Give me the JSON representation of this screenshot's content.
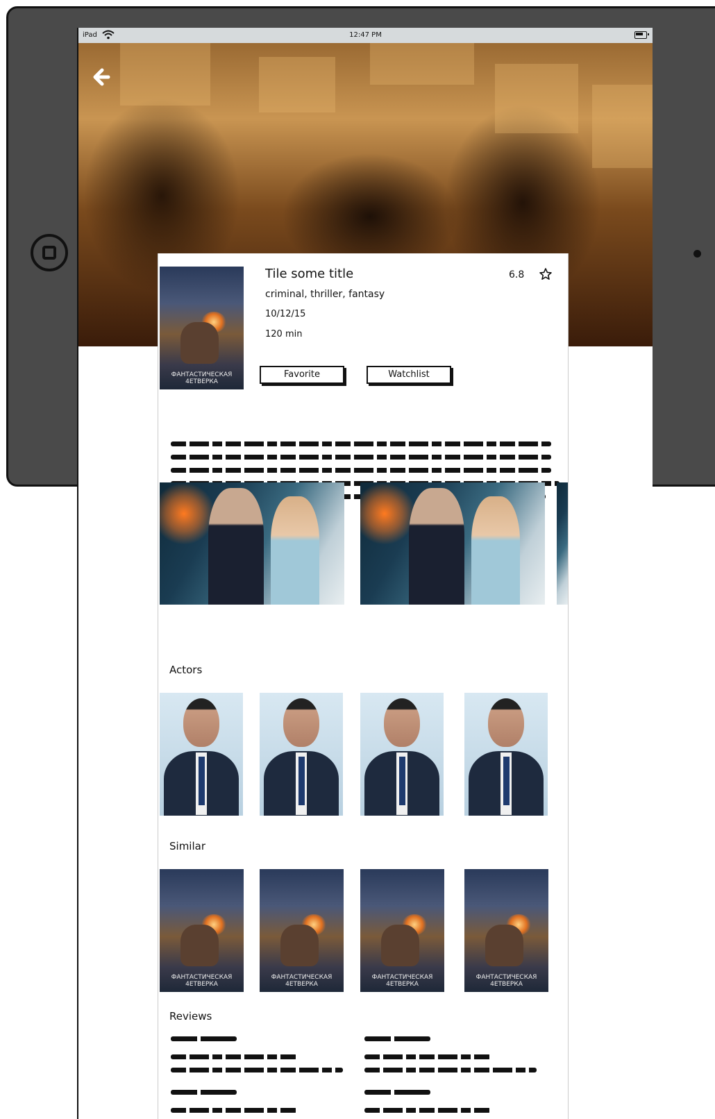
{
  "status_bar": {
    "carrier": "iPad",
    "time": "12:47 PM"
  },
  "movie": {
    "title": "Tile some title",
    "rating": "6.8",
    "genres": "criminal, thriller, fantasy",
    "date": "10/12/15",
    "duration": "120 min",
    "poster_caption_line1": "ФАНТАСТИЧЕСКАЯ",
    "poster_caption_line2": "4ЕТВЕРКА"
  },
  "buttons": {
    "favorite": "Favorite",
    "watchlist": "Watchlist"
  },
  "sections": {
    "actors": "Actors",
    "similar": "Similar",
    "reviews": "Reviews"
  },
  "icons": {
    "back": "back-arrow-icon",
    "star": "star-icon",
    "wifi": "wifi-icon",
    "battery": "battery-icon",
    "home": "home-button-icon"
  },
  "colors": {
    "status_bar_bg": "#d6dadc",
    "device_frame": "#4a4a4a",
    "hero_tone": "#9a6a33"
  }
}
